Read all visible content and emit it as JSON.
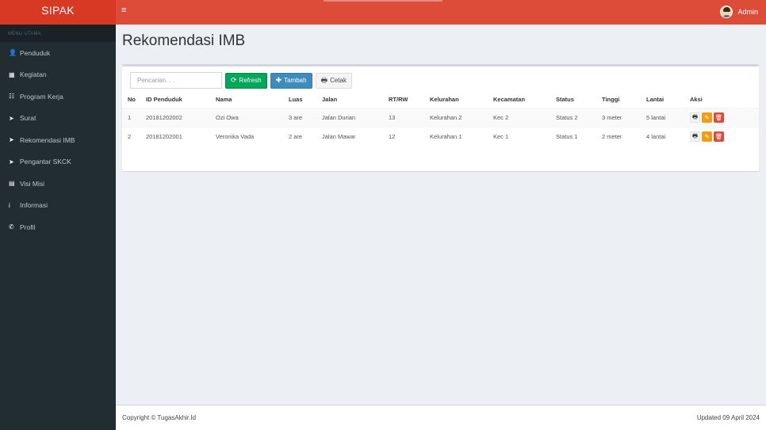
{
  "app": {
    "brand": "SIPAK",
    "hamburger_icon": "≡"
  },
  "user": {
    "name": "Admin"
  },
  "sidebar": {
    "header": "MENU UTAMA",
    "items": [
      {
        "label": "Penduduk",
        "icon": "👤"
      },
      {
        "label": "Kegiatan",
        "icon": "▦"
      },
      {
        "label": "Program Kerja",
        "icon": "☷"
      },
      {
        "label": "Surat",
        "icon": "➤"
      },
      {
        "label": "Rekomendasi IMB",
        "icon": "➤"
      },
      {
        "label": "Pengantar SKCK",
        "icon": "➤"
      },
      {
        "label": "Visi Misi",
        "icon": "▤"
      },
      {
        "label": "Informasi",
        "icon": "i"
      },
      {
        "label": "Profil",
        "icon": "✆"
      }
    ]
  },
  "page": {
    "title": "Rekomendasi IMB"
  },
  "toolbar": {
    "search_placeholder": "Pencarian. . .",
    "search_value": "",
    "refresh_label": "Refresh",
    "refresh_icon": "⟳",
    "tambah_label": "Tambah",
    "tambah_icon": "✚",
    "cetak_label": "Cetak",
    "cetak_icon": "🖶"
  },
  "table": {
    "columns": [
      "No",
      "ID Penduduk",
      "Nama",
      "Luas",
      "Jalan",
      "RT/RW",
      "Kelurahan",
      "Kecamatan",
      "Status",
      "Tinggi",
      "Lantai",
      "Aksi"
    ],
    "rows": [
      [
        "1",
        "20181202002",
        "Ozi Owa",
        "3 are",
        "Jalan Durian",
        "13",
        "Kelurahan 2",
        "Kec 2",
        "Status 2",
        "3 meter",
        "5 lantai"
      ],
      [
        "2",
        "20181202001",
        "Veronika Vada",
        "2 are",
        "Jalan Mawar",
        "12",
        "Kelurahan 1",
        "Kec 1",
        "Status 1",
        "2 meter",
        "4 lantai"
      ]
    ],
    "action_icons": {
      "print": "🖶",
      "edit": "✎",
      "delete": "🗑"
    }
  },
  "footer": {
    "copyright": "Copyright © TugasAkhir.Id",
    "updated": "Updated 09 April 2024"
  }
}
